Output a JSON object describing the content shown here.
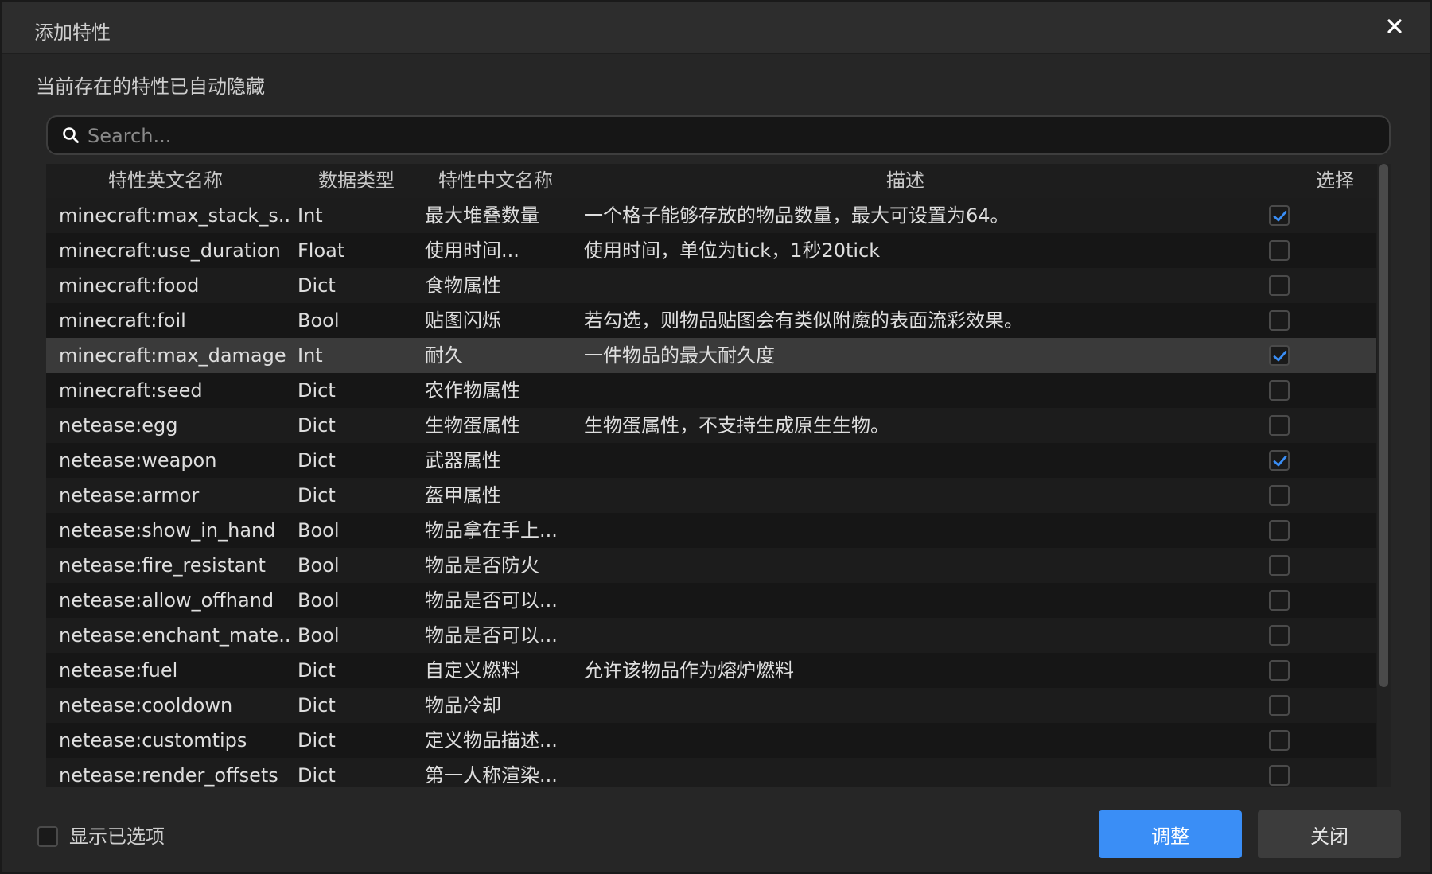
{
  "dialog": {
    "title": "添加特性",
    "subtitle": "当前存在的特性已自动隐藏"
  },
  "search": {
    "placeholder": "Search...",
    "value": ""
  },
  "table": {
    "columns": [
      "特性英文名称",
      "数据类型",
      "特性中文名称",
      "描述",
      "选择"
    ],
    "rows": [
      {
        "en": "minecraft:max_stack_s...",
        "type": "Int",
        "cn": "最大堆叠数量",
        "desc": "一个格子能够存放的物品数量，最大可设置为64。",
        "checked": true
      },
      {
        "en": "minecraft:use_duration",
        "type": "Float",
        "cn": "使用时间...",
        "desc": "使用时间，单位为tick，1秒20tick",
        "checked": false
      },
      {
        "en": "minecraft:food",
        "type": "Dict",
        "cn": "食物属性",
        "desc": "",
        "checked": false
      },
      {
        "en": "minecraft:foil",
        "type": "Bool",
        "cn": "贴图闪烁",
        "desc": "若勾选，则物品贴图会有类似附魔的表面流彩效果。",
        "checked": false
      },
      {
        "en": "minecraft:max_damage",
        "type": "Int",
        "cn": "耐久",
        "desc": "一件物品的最大耐久度",
        "checked": true,
        "highlight": true
      },
      {
        "en": "minecraft:seed",
        "type": "Dict",
        "cn": "农作物属性",
        "desc": "",
        "checked": false
      },
      {
        "en": "netease:egg",
        "type": "Dict",
        "cn": "生物蛋属性",
        "desc": "生物蛋属性，不支持生成原生生物。",
        "checked": false
      },
      {
        "en": "netease:weapon",
        "type": "Dict",
        "cn": "武器属性",
        "desc": "",
        "checked": true
      },
      {
        "en": "netease:armor",
        "type": "Dict",
        "cn": "盔甲属性",
        "desc": "",
        "checked": false
      },
      {
        "en": "netease:show_in_hand",
        "type": "Bool",
        "cn": "物品拿在手上...",
        "desc": "",
        "checked": false
      },
      {
        "en": "netease:fire_resistant",
        "type": "Bool",
        "cn": "物品是否防火",
        "desc": "",
        "checked": false
      },
      {
        "en": "netease:allow_offhand",
        "type": "Bool",
        "cn": "物品是否可以...",
        "desc": "",
        "checked": false
      },
      {
        "en": "netease:enchant_mate...",
        "type": "Bool",
        "cn": "物品是否可以...",
        "desc": "",
        "checked": false
      },
      {
        "en": "netease:fuel",
        "type": "Dict",
        "cn": "自定义燃料",
        "desc": "允许该物品作为熔炉燃料",
        "checked": false
      },
      {
        "en": "netease:cooldown",
        "type": "Dict",
        "cn": "物品冷却",
        "desc": "",
        "checked": false
      },
      {
        "en": "netease:customtips",
        "type": "Dict",
        "cn": "定义物品描述...",
        "desc": "",
        "checked": false
      },
      {
        "en": "netease:render_offsets",
        "type": "Dict",
        "cn": "第一人称渲染...",
        "desc": "",
        "checked": false
      }
    ]
  },
  "footer": {
    "show_selected_label": "显示已选项",
    "adjust_label": "调整",
    "close_label": "关闭"
  },
  "colors": {
    "accent": "#3a8ef6",
    "checkmark": "#3a8ef6"
  }
}
